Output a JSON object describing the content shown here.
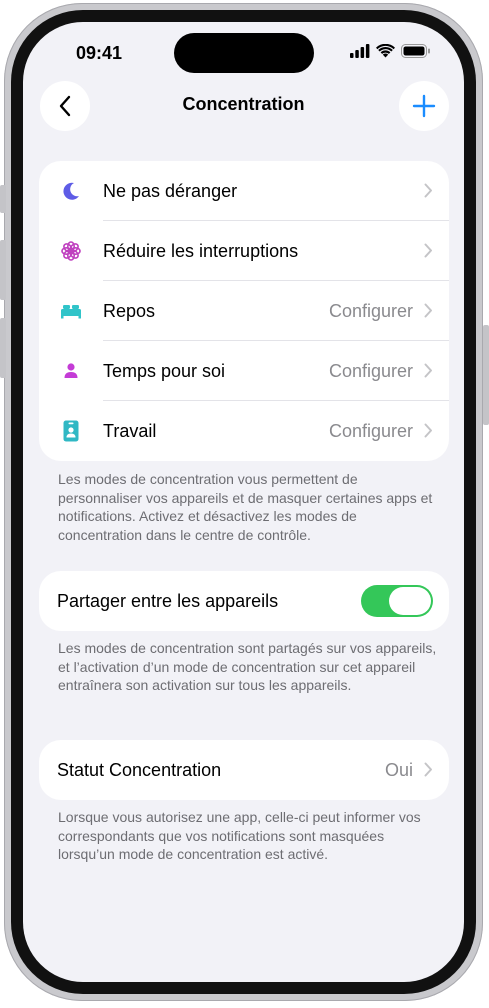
{
  "status_bar": {
    "time": "09:41"
  },
  "nav": {
    "title": "Concentration",
    "back_icon": "chevron-left-icon",
    "add_icon": "plus-icon",
    "accent": "#1a8cff"
  },
  "focus_modes": [
    {
      "label": "Ne pas déranger",
      "value": "",
      "icon": "moon-icon",
      "color": "#5e5ce6"
    },
    {
      "label": "Réduire les interruptions",
      "value": "",
      "icon": "flower-icon",
      "color": "#bf40bf"
    },
    {
      "label": "Repos",
      "value": "Configurer",
      "icon": "bed-icon",
      "color": "#30c4c9"
    },
    {
      "label": "Temps pour soi",
      "value": "Configurer",
      "icon": "person-icon",
      "color": "#c43cd6"
    },
    {
      "label": "Travail",
      "value": "Configurer",
      "icon": "id-badge-icon",
      "color": "#30b8c4"
    }
  ],
  "focus_footnote": "Les modes de concentration vous permettent de personnaliser vos appareils et de masquer certaines apps et notifications. Activez et désactivez les modes de concentration dans le centre de contrôle.",
  "share": {
    "label": "Partager entre les appareils",
    "enabled": true,
    "toggle_color": "#34c759"
  },
  "share_footnote": "Les modes de concentration sont partagés sur vos appareils, et l’activation d’un mode de concentration sur cet appareil entraînera son activation sur tous les appareils.",
  "status": {
    "label": "Statut Concentration",
    "value": "Oui"
  },
  "status_footnote": "Lorsque vous autorisez une app, celle-ci peut informer vos correspondants que vos notifications sont masquées lorsqu’un mode de concentration est activé."
}
